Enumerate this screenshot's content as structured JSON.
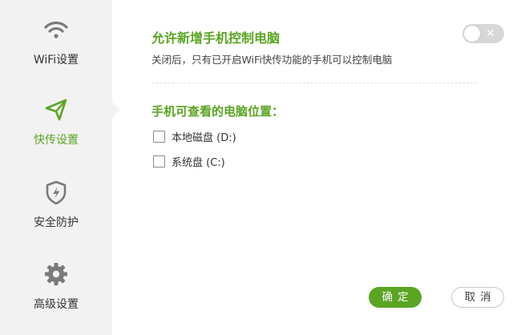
{
  "sidebar": {
    "items": [
      {
        "label": "WiFi设置",
        "icon": "wifi-icon",
        "active": false
      },
      {
        "label": "快传设置",
        "icon": "paper-plane-icon",
        "active": true
      },
      {
        "label": "安全防护",
        "icon": "shield-lightning-icon",
        "active": false
      },
      {
        "label": "高级设置",
        "icon": "gear-icon",
        "active": false
      }
    ]
  },
  "main": {
    "allow_control": {
      "title": "允许新增手机控制电脑",
      "description": "关闭后，只有已开启WiFi快传功能的手机可以控制电脑",
      "toggle_on": false,
      "toggle_symbol": "✕"
    },
    "locations": {
      "title": "手机可查看的电脑位置：",
      "options": [
        {
          "label": "本地磁盘 (D:)",
          "checked": false
        },
        {
          "label": "系统盘 (C:)",
          "checked": false
        }
      ]
    }
  },
  "buttons": {
    "confirm": "确定",
    "cancel": "取消"
  },
  "colors": {
    "accent": "#5aa522",
    "sidebar_bg": "#f2f2f2",
    "icon_gray": "#7a7a7a"
  }
}
